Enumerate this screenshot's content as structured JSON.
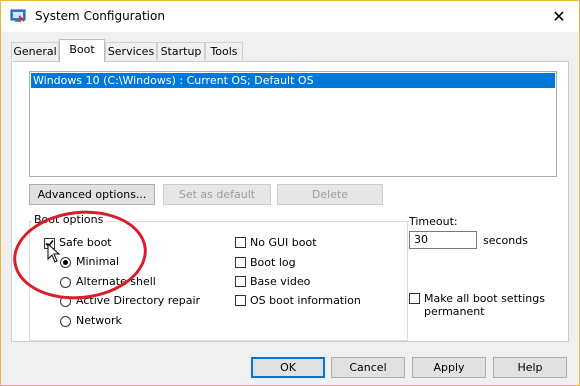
{
  "window": {
    "title": "System Configuration"
  },
  "tabs": [
    {
      "label": "General"
    },
    {
      "label": "Boot"
    },
    {
      "label": "Services"
    },
    {
      "label": "Startup"
    },
    {
      "label": "Tools"
    }
  ],
  "os_list": {
    "items": [
      "Windows 10 (C:\\Windows) : Current OS; Default OS"
    ]
  },
  "os_buttons": {
    "advanced": "Advanced options...",
    "set_default": "Set as default",
    "delete": "Delete"
  },
  "boot_options": {
    "label": "Boot options",
    "safe_boot": {
      "label": "Safe boot",
      "checked": true
    },
    "minimal": {
      "label": "Minimal",
      "selected": true
    },
    "alternate_shell": {
      "label": "Alternate shell"
    },
    "ad_repair": {
      "label": "Active Directory repair"
    },
    "network": {
      "label": "Network"
    },
    "no_gui": {
      "label": "No GUI boot",
      "checked": false
    },
    "boot_log": {
      "label": "Boot log",
      "checked": false
    },
    "base_video": {
      "label": "Base video",
      "checked": false
    },
    "os_boot_info": {
      "label": "OS boot information",
      "checked": false
    }
  },
  "timeout": {
    "label": "Timeout:",
    "value": "30",
    "unit": "seconds"
  },
  "make_permanent": {
    "label_line1": "Make all boot settings",
    "label_line2": "permanent",
    "checked": false
  },
  "footer": {
    "ok": "OK",
    "cancel": "Cancel",
    "apply": "Apply",
    "help": "Help"
  },
  "colors": {
    "selection": "#0078d7",
    "annotation": "#d81e2a",
    "focus_border": "#f0b43c"
  }
}
